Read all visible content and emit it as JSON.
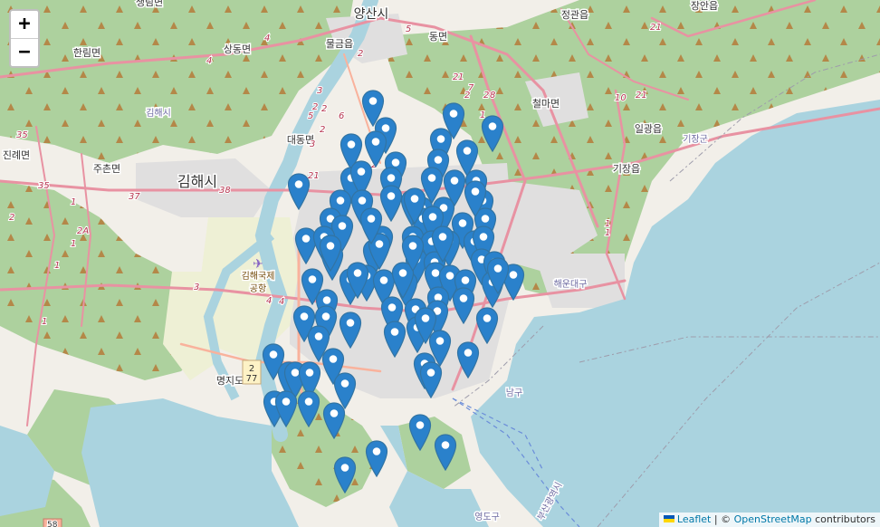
{
  "map": {
    "place_labels": [
      {
        "text": "양산시",
        "size": "big"
      },
      {
        "text": "물금읍",
        "size": "mid"
      },
      {
        "text": "동면",
        "size": "mid"
      },
      {
        "text": "정관읍",
        "size": "mid"
      },
      {
        "text": "장안읍",
        "size": "mid"
      },
      {
        "text": "생림면",
        "size": "mid"
      },
      {
        "text": "상동면",
        "size": "mid"
      },
      {
        "text": "한림면",
        "size": "mid"
      },
      {
        "text": "철마면",
        "size": "mid"
      },
      {
        "text": "일광읍",
        "size": "mid"
      },
      {
        "text": "기장군",
        "size": "small_blue"
      },
      {
        "text": "김해시",
        "size": "small"
      },
      {
        "text": "대동면",
        "size": "mid"
      },
      {
        "text": "진례면",
        "size": "mid"
      },
      {
        "text": "주촌면",
        "size": "mid"
      },
      {
        "text": "김해시",
        "size": "big"
      },
      {
        "text": "기장읍",
        "size": "mid"
      },
      {
        "text": "김해국제",
        "size": "poi"
      },
      {
        "text": "공항",
        "size": "poi"
      },
      {
        "text": "해운대구",
        "size": "small_blue"
      },
      {
        "text": "명지도",
        "size": "mid"
      },
      {
        "text": "남구",
        "size": "small_blue"
      },
      {
        "text": "영도구",
        "size": "small_blue"
      },
      {
        "text": "부산광역시",
        "size": "boundary"
      }
    ],
    "road_shields": [
      "4",
      "2",
      "5",
      "4",
      "2",
      "3",
      "2",
      "2",
      "5",
      "6",
      "2",
      "2",
      "2",
      "2",
      "1",
      "21",
      "2",
      "7",
      "2",
      "8",
      "10",
      "21",
      "1",
      "1",
      "35",
      "21",
      "35",
      "1",
      "37",
      "38",
      "2",
      "2A",
      "3",
      "4",
      "4",
      "1",
      "1",
      "1",
      "1",
      "58",
      "3"
    ],
    "airport_shield": [
      "2",
      "77"
    ],
    "marker_count": 130
  },
  "zoom": {
    "in_label": "+",
    "out_label": "−"
  },
  "attribution": {
    "leaflet": "Leaflet",
    "separator": " | © ",
    "osm": "OpenStreetMap",
    "contributors": " contributors"
  },
  "colors": {
    "water": "#aad3df",
    "land": "#f2efe9",
    "forest": "#add19e",
    "urban": "#e0dfdf",
    "road_major": "#e892a2",
    "road_trunk": "#f9b29c",
    "marker": "#2a81cb"
  }
}
